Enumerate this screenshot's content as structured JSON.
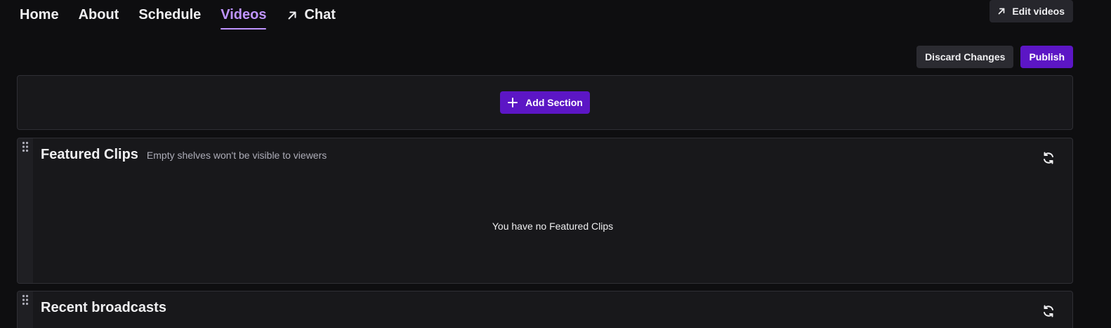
{
  "nav": {
    "items": [
      {
        "label": "Home",
        "active": false
      },
      {
        "label": "About",
        "active": false
      },
      {
        "label": "Schedule",
        "active": false
      },
      {
        "label": "Videos",
        "active": true
      },
      {
        "label": "Chat",
        "active": false,
        "icon": "external-arrow-icon"
      }
    ]
  },
  "toolbar": {
    "edit_videos_label": "Edit videos",
    "discard_label": "Discard Changes",
    "publish_label": "Publish"
  },
  "add_section": {
    "label": "Add Section"
  },
  "shelves": [
    {
      "title": "Featured Clips",
      "subtitle": "Empty shelves won't be visible to viewers",
      "empty_message": "You have no Featured Clips"
    },
    {
      "title": "Recent broadcasts"
    }
  ],
  "colors": {
    "accent": "#bf94ff",
    "primary_button": "#5c16c5",
    "background": "#0e0e10",
    "panel": "#18181b"
  }
}
